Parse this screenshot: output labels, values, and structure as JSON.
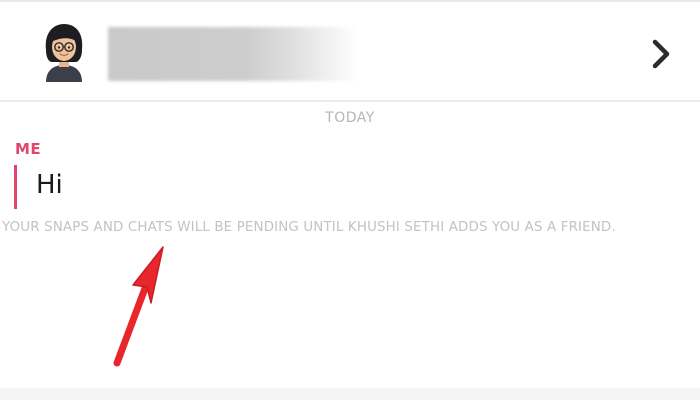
{
  "chat": {
    "header": {
      "avatar_icon": "bitmoji-avatar-icon",
      "chevron_icon": "chevron-right-icon"
    },
    "date_separator": "TODAY",
    "message": {
      "sender": "ME",
      "text": "Hi",
      "accent_color": "#e0456b"
    },
    "pending_notice": "YOUR SNAPS AND CHATS WILL BE PENDING UNTIL KHUSHI SETHI ADDS YOU AS A FRIEND.",
    "annotation_arrow_color": "#e8262b"
  }
}
